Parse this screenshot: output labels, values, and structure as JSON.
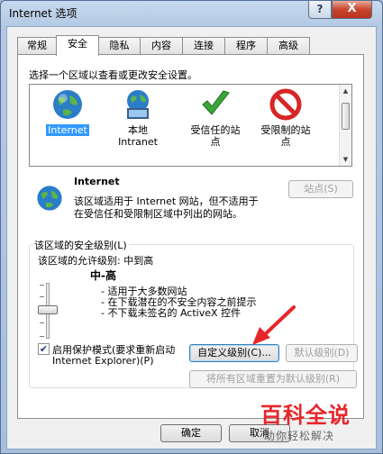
{
  "window": {
    "title": "Internet 选项",
    "help_glyph": "?",
    "close_glyph": "X"
  },
  "tabs": [
    "常规",
    "安全",
    "隐私",
    "内容",
    "连接",
    "程序",
    "高级"
  ],
  "zone_instruction": "选择一个区域以查看或更改安全设置。",
  "zones": [
    {
      "line1": "Internet",
      "line2": "",
      "icon": "globe-icon"
    },
    {
      "line1": "本地",
      "line2": "Intranet",
      "icon": "intranet-icon"
    },
    {
      "line1": "受信任的站",
      "line2": "点",
      "icon": "check-icon"
    },
    {
      "line1": "受限制的站",
      "line2": "点",
      "icon": "restricted-icon"
    }
  ],
  "zone_info": {
    "name": "Internet",
    "desc1": "该区域适用于 Internet 网站，但不适用于",
    "desc2": "在受信任和受限制区域中列出的网站。",
    "sites_button": "站点(S)"
  },
  "security": {
    "group_title": "该区域的安全级别(L)",
    "allowed": "该区域的允许级别: 中到高",
    "level": "中-高",
    "bullets": [
      "- 适用于大多数网站",
      "- 在下载潜在的不安全内容之前提示",
      "- 不下载未签名的 ActiveX 控件"
    ],
    "protected_mode_line1": "启用保护模式(要求重新启动",
    "protected_mode_line2": "Internet Explorer)(P)",
    "protected_mode_checked": true,
    "custom_button": "自定义级别(C)...",
    "default_button": "默认级别(D)",
    "reset_all_button": "将所有区域重置为默认级别(R)"
  },
  "footer": {
    "ok_button": "确定",
    "cancel_button": "取消"
  },
  "watermark": {
    "line1": "百科全说",
    "line2": "助你轻松解决"
  },
  "colors": {
    "accent_red": "#e8262a",
    "selection": "#3399ff"
  }
}
